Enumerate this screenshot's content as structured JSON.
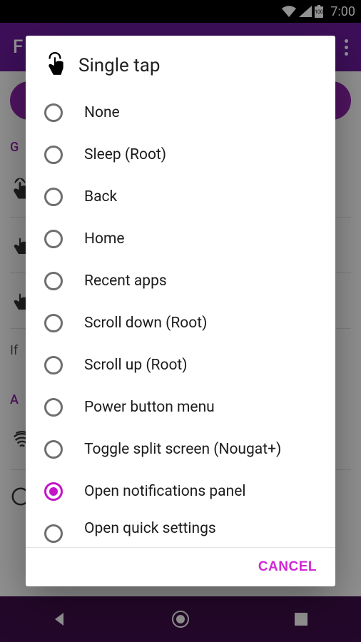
{
  "status": {
    "time": "7:00",
    "battery": "100"
  },
  "appbar": {
    "title": "F"
  },
  "bg": {
    "section_gestures": "G",
    "if_text": "If",
    "section_a": "A"
  },
  "dialog": {
    "title": "Single tap",
    "options": [
      {
        "label": "None",
        "selected": false
      },
      {
        "label": "Sleep (Root)",
        "selected": false
      },
      {
        "label": "Back",
        "selected": false
      },
      {
        "label": "Home",
        "selected": false
      },
      {
        "label": "Recent apps",
        "selected": false
      },
      {
        "label": "Scroll down (Root)",
        "selected": false
      },
      {
        "label": "Scroll up (Root)",
        "selected": false
      },
      {
        "label": "Power button menu",
        "selected": false
      },
      {
        "label": "Toggle split screen (Nougat+)",
        "selected": false
      },
      {
        "label": "Open notifications panel",
        "selected": true
      },
      {
        "label": "Open quick settings",
        "selected": false
      }
    ],
    "cancel": "CANCEL"
  }
}
